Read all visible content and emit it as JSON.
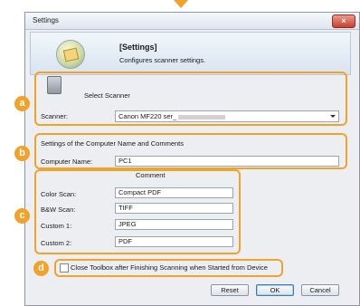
{
  "window": {
    "title": "Settings",
    "close_glyph": "×"
  },
  "header": {
    "title": "[Settings]",
    "description": "Configures scanner settings."
  },
  "badges": {
    "a": "a",
    "b": "b",
    "c": "c",
    "d": "d"
  },
  "scanner": {
    "section_label": "Select Scanner",
    "field_label": "Scanner:",
    "value": "Canon MF220 ser_"
  },
  "computer": {
    "section_label": "Settings of the Computer Name and Comments",
    "name_label": "Computer Name:",
    "name_value": "PC1"
  },
  "comments": {
    "header": "Comment",
    "rows": [
      {
        "label": "Color Scan:",
        "value": "Compact PDF"
      },
      {
        "label": "B&W Scan:",
        "value": "TIFF"
      },
      {
        "label": "Custom 1:",
        "value": "JPEG"
      },
      {
        "label": "Custom 2:",
        "value": "PDF"
      }
    ]
  },
  "option": {
    "close_toolbox_label": "Close Toolbox after Finishing Scanning when Started from Device",
    "checked": false
  },
  "buttons": {
    "reset": "Reset",
    "ok": "OK",
    "cancel": "Cancel"
  },
  "colors": {
    "accent": "#f0a22a"
  }
}
